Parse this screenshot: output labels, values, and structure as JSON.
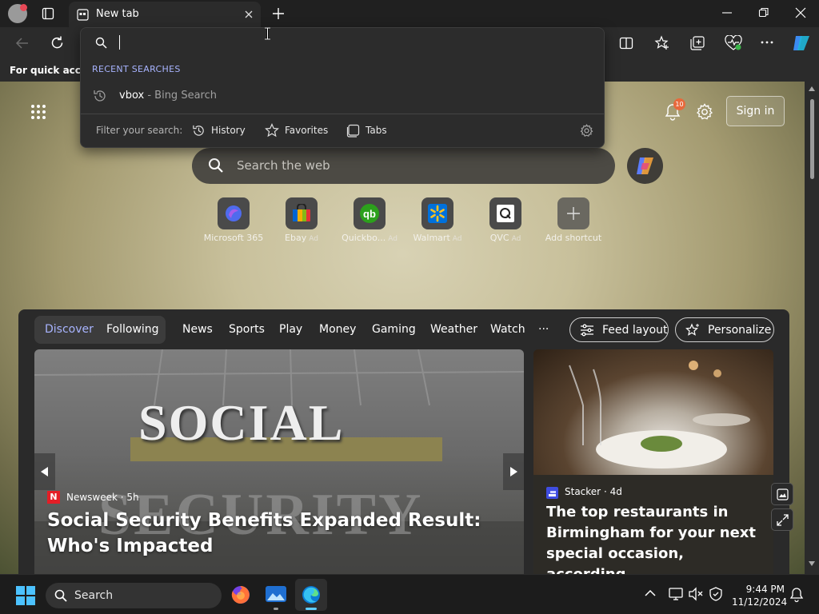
{
  "browser": {
    "tab_title": "New tab",
    "favorites_hint": "For quick access"
  },
  "address": {
    "recent_heading": "RECENT SEARCHES",
    "recent_item": "vbox",
    "recent_item_source": " - Bing Search",
    "filter_label": "Filter your search:",
    "filters": [
      "History",
      "Favorites",
      "Tabs"
    ]
  },
  "page": {
    "sign_in": "Sign in",
    "notification_count": "10",
    "search_placeholder": "Search the web",
    "shortcuts": [
      {
        "label": "Microsoft 365",
        "ad": ""
      },
      {
        "label": "Ebay",
        "ad": "Ad"
      },
      {
        "label": "Quickbo...",
        "ad": "Ad"
      },
      {
        "label": "Walmart",
        "ad": "Ad"
      },
      {
        "label": "QVC",
        "ad": "Ad"
      },
      {
        "label": "Add shortcut",
        "ad": ""
      }
    ]
  },
  "feed": {
    "tabs": [
      "Discover",
      "Following",
      "News",
      "Sports",
      "Play",
      "Money",
      "Gaming",
      "Weather",
      "Watch",
      "···"
    ],
    "feed_layout": "Feed layout",
    "personalize": "Personalize",
    "card1": {
      "source": "Newsweek",
      "age": "· 5h",
      "headline": "Social Security Benefits Expanded Result: Who's Impacted",
      "image_text_top": "SOCIAL",
      "image_text_bottom": "SECURITY"
    },
    "card2": {
      "source": "Stacker",
      "age": "· 4d",
      "headline": "The top restaurants in Birmingham for your next special occasion, according..."
    }
  },
  "taskbar": {
    "search": "Search",
    "time": "9:44 PM",
    "date": "11/12/2024"
  },
  "colors": {
    "accent": "#a8b4ff",
    "notification_badge": "#e8693c"
  }
}
